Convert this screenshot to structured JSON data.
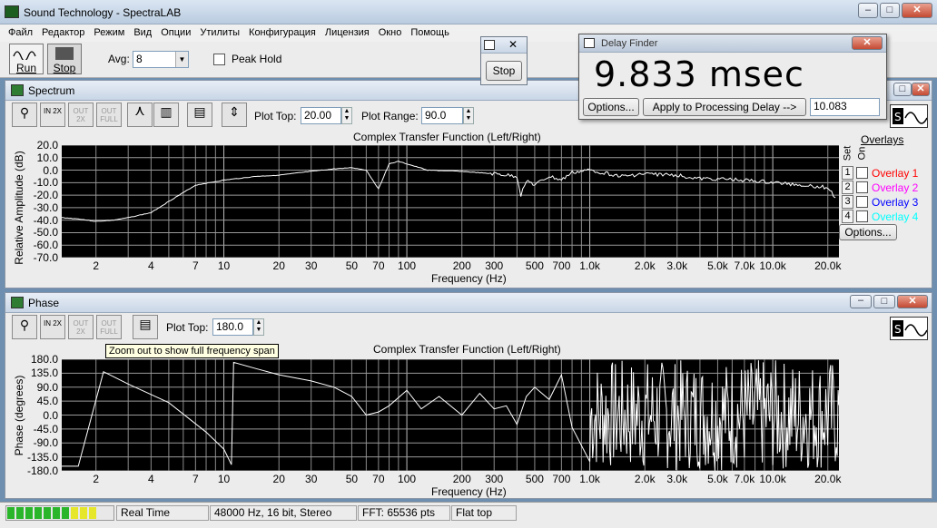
{
  "app": {
    "title": "Sound Technology - SpectraLAB"
  },
  "menu": [
    "Файл",
    "Редактор",
    "Режим",
    "Вид",
    "Опции",
    "Утилиты",
    "Конфигурация",
    "Лицензия",
    "Окно",
    "Помощь"
  ],
  "toolbar": {
    "run_label": "Run",
    "stop_label": "Stop",
    "avg_label": "Avg:",
    "avg_value": "8",
    "peak_hold_label": "Peak Hold"
  },
  "stop_popup": {
    "stop_label": "Stop"
  },
  "delay_finder": {
    "title": "Delay Finder",
    "delay_value": "9.833 msec",
    "options_label": "Options...",
    "apply_label": "Apply to Processing Delay -->",
    "processing_delay_value": "10.083"
  },
  "spectrum": {
    "title": "Spectrum",
    "tools": {
      "zoom_in": "IN 2X",
      "zoom_out": "OUT 2X",
      "zoom_full": "OUT FULL"
    },
    "plot_top_label": "Plot Top:",
    "plot_top_value": "20.00",
    "plot_range_label": "Plot Range:",
    "plot_range_value": "90.0",
    "overlays": {
      "title": "Overlays",
      "set_label": "Set",
      "on_label": "On",
      "options_label": "Options...",
      "items": [
        {
          "num": "1",
          "label": "Overlay 1",
          "color": "#ff0000"
        },
        {
          "num": "2",
          "label": "Overlay 2",
          "color": "#ff00ff"
        },
        {
          "num": "3",
          "label": "Overlay 3",
          "color": "#0000ff"
        },
        {
          "num": "4",
          "label": "Overlay 4",
          "color": "#00ffff"
        }
      ]
    }
  },
  "phase": {
    "title": "Phase",
    "tools": {
      "zoom_in": "IN 2X",
      "zoom_out": "OUT 2X",
      "zoom_full": "OUT FULL"
    },
    "plot_top_label": "Plot Top:",
    "plot_top_value": "180.0",
    "tooltip": "Zoom out to show full frequency span"
  },
  "chart_data": [
    {
      "type": "line",
      "title": "Complex Transfer Function (Left/Right)",
      "xlabel": "Frequency (Hz)",
      "ylabel": "Relative Amplitude (dB)",
      "x_scale": "log",
      "xlim": [
        1.3,
        23000
      ],
      "ylim": [
        -70,
        20
      ],
      "grid": true,
      "yticks": [
        "20.0",
        "10.0",
        "0.0",
        "-10.0",
        "-20.0",
        "-30.0",
        "-40.0",
        "-50.0",
        "-60.0",
        "-70.0"
      ],
      "xticks": [
        "2",
        "4",
        "7",
        "10",
        "20",
        "30",
        "50",
        "70",
        "100",
        "200",
        "300",
        "500",
        "700",
        "1.0k",
        "2.0k",
        "3.0k",
        "5.0k",
        "7.0k",
        "10.0k",
        "20.0k"
      ],
      "series": [
        {
          "color": "#ffffff",
          "x": [
            1.3,
            1.6,
            2,
            2.5,
            3,
            4,
            5,
            7,
            10,
            15,
            20,
            30,
            40,
            50,
            60,
            70,
            80,
            90,
            100,
            130,
            200,
            300,
            400,
            420,
            450,
            500,
            600,
            700,
            800,
            1000,
            1500,
            2000,
            3000,
            4000,
            5000,
            7000,
            10000,
            15000,
            20000,
            22000
          ],
          "y": [
            -38,
            -39,
            -41,
            -40,
            -38,
            -34,
            -25,
            -12,
            -8,
            -5,
            -4,
            -1,
            1,
            2,
            0,
            -15,
            5,
            7,
            5,
            0,
            -1,
            -3,
            -5,
            -20,
            -8,
            -12,
            -5,
            -8,
            -2,
            0,
            -5,
            -3,
            -4,
            -7,
            -7,
            -8,
            -10,
            -12,
            -14,
            -22
          ]
        }
      ]
    },
    {
      "type": "line",
      "title": "Complex Transfer Function (Left/Right)",
      "xlabel": "Frequency (Hz)",
      "ylabel": "Phase (degrees)",
      "x_scale": "log",
      "xlim": [
        1.3,
        23000
      ],
      "ylim": [
        -180,
        180
      ],
      "grid": true,
      "yticks": [
        "180.0",
        "135.0",
        "90.0",
        "45.0",
        "0.0",
        "-45.0",
        "-90.0",
        "-135.0",
        "-180.0"
      ],
      "xticks": [
        "2",
        "4",
        "7",
        "10",
        "20",
        "30",
        "50",
        "70",
        "100",
        "200",
        "300",
        "500",
        "700",
        "1.0k",
        "2.0k",
        "3.0k",
        "5.0k",
        "7.0k",
        "10.0k",
        "20.0k"
      ],
      "series": [
        {
          "color": "#ffffff",
          "x": [
            1.3,
            1.6,
            2.2,
            3,
            5,
            8,
            10,
            11,
            11.3,
            15,
            20,
            30,
            40,
            50,
            60,
            70,
            80,
            100,
            120,
            150,
            200,
            250,
            300,
            350,
            400,
            450,
            500,
            600,
            700,
            800,
            1000
          ],
          "y": [
            -165,
            -165,
            140,
            100,
            40,
            -55,
            -110,
            -160,
            170,
            150,
            130,
            110,
            90,
            60,
            0,
            10,
            30,
            80,
            20,
            60,
            0,
            70,
            20,
            30,
            -30,
            60,
            90,
            50,
            130,
            -40,
            -150
          ]
        }
      ]
    }
  ],
  "status": {
    "mode": "Real Time",
    "format": "48000 Hz, 16 bit, Stereo",
    "fft": "FFT: 65536 pts",
    "window": "Flat top"
  }
}
